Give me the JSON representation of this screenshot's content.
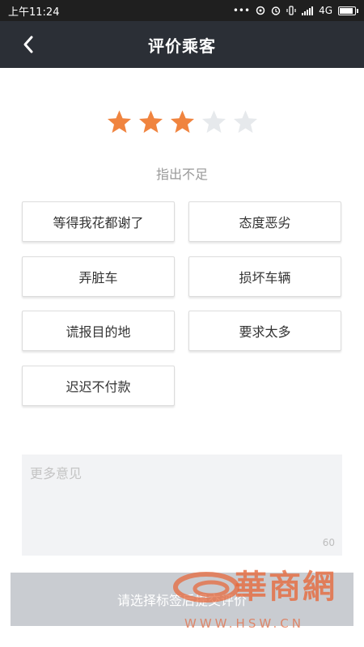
{
  "status_bar": {
    "time": "上午11:24",
    "network": "4G"
  },
  "header": {
    "title": "评价乘客",
    "back_icon": "chevron-left-icon"
  },
  "rating": {
    "stars": 3,
    "max": 5,
    "label": "指出不足",
    "filled_color": "#f0843f",
    "empty_color": "#e6e9ec"
  },
  "tags": [
    {
      "label": "等得我花都谢了"
    },
    {
      "label": "态度恶劣"
    },
    {
      "label": "弄脏车"
    },
    {
      "label": "损坏车辆"
    },
    {
      "label": "谎报目的地"
    },
    {
      "label": "要求太多"
    },
    {
      "label": "迟迟不付款"
    }
  ],
  "comment": {
    "placeholder": "更多意见",
    "value": "",
    "max_length": "60"
  },
  "submit": {
    "label": "请选择标签后提交评价"
  },
  "watermark": {
    "brand": "華商網",
    "url": "WWW.HSW.CN"
  }
}
